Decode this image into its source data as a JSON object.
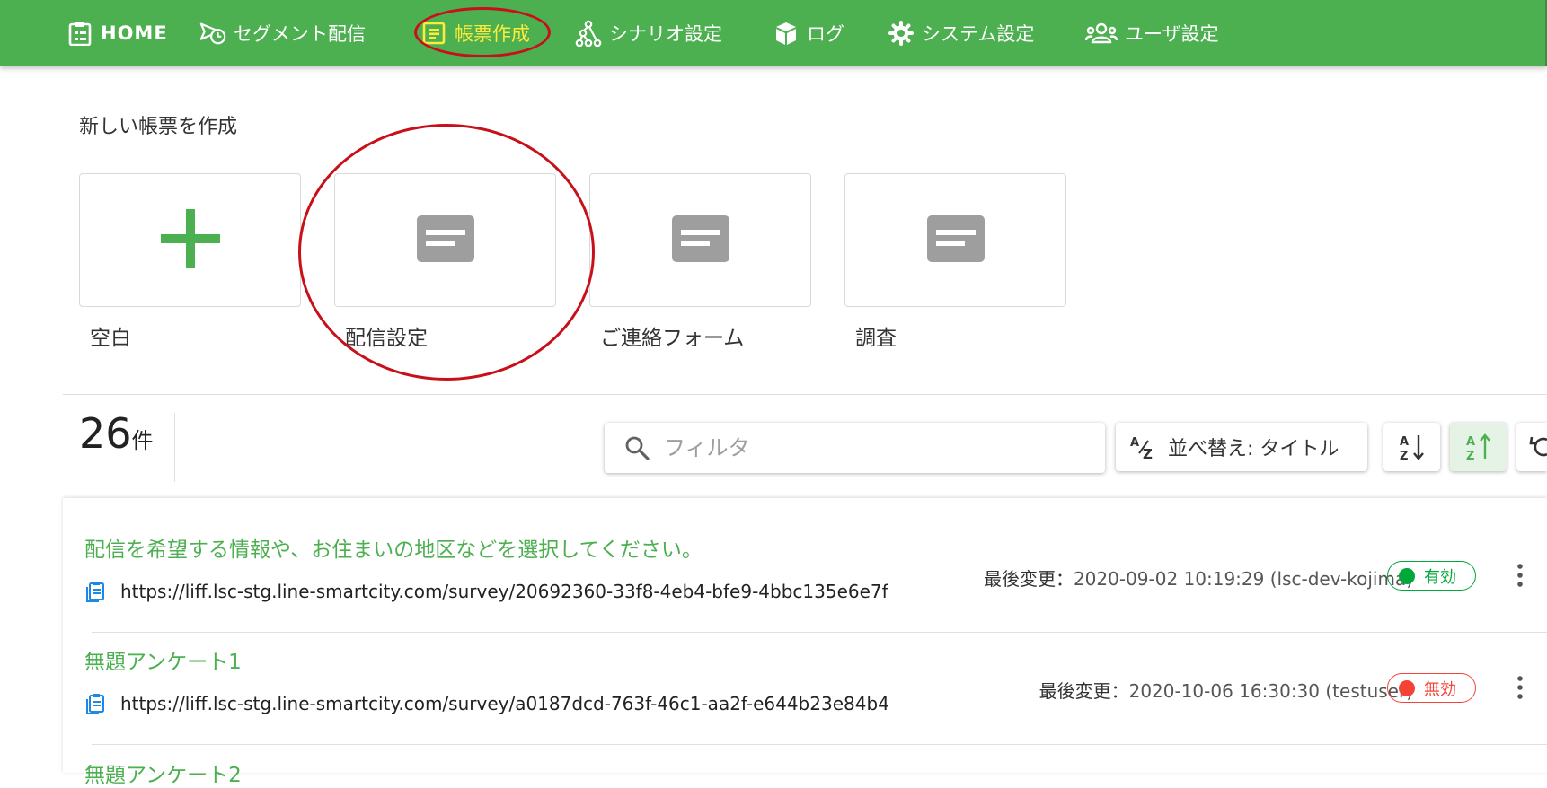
{
  "nav": {
    "items": [
      {
        "label": "HOME",
        "icon": "clipboard-list-icon"
      },
      {
        "label": "セグメント配信",
        "icon": "send-clock-icon"
      },
      {
        "label": "帳票作成",
        "icon": "form-icon"
      },
      {
        "label": "シナリオ設定",
        "icon": "graph-icon"
      },
      {
        "label": "ログ",
        "icon": "box-icon"
      },
      {
        "label": "システム設定",
        "icon": "gear-icon"
      },
      {
        "label": "ユーザ設定",
        "icon": "users-icon"
      }
    ],
    "active": "帳票作成",
    "color": "#4caf50",
    "active_color": "#ffeb3b"
  },
  "create": {
    "title": "新しい帳票を作成",
    "templates": [
      {
        "label": "空白",
        "icon": "plus-icon"
      },
      {
        "label": "配信設定",
        "icon": "form-template-icon"
      },
      {
        "label": "ご連絡フォーム",
        "icon": "form-template-icon"
      },
      {
        "label": "調査",
        "icon": "form-template-icon"
      }
    ]
  },
  "toolbar": {
    "count": "26",
    "count_unit": "件",
    "filter_placeholder": "フィルタ",
    "sort_label": "並べ替え: タイトル"
  },
  "list": {
    "items": [
      {
        "title": "配信を希望する情報や、お住まいの地区などを選択してください。",
        "url": "https://liff.lsc-stg.line-smartcity.com/survey/20692360-33f8-4eb4-bfe9-4bbc135e6e7f",
        "modified_label": "最後変更：",
        "modified_value": "2020-09-02 10:19:29 (lsc-dev-kojima)",
        "status": "有効",
        "status_color": "#00a83a"
      },
      {
        "title": "無題アンケート1",
        "url": "https://liff.lsc-stg.line-smartcity.com/survey/a0187dcd-763f-46c1-aa2f-e644b23e84b4",
        "modified_label": "最後変更：",
        "modified_value": "2020-10-06 16:30:30 (testuser)",
        "status": "無効",
        "status_color": "#f44336"
      },
      {
        "title": "無題アンケート2"
      }
    ]
  },
  "colors": {
    "accent": "#4caf50",
    "annotation": "#c8101a",
    "template_icon": "#9e9e9e",
    "url_icon": "#1e88e5"
  }
}
